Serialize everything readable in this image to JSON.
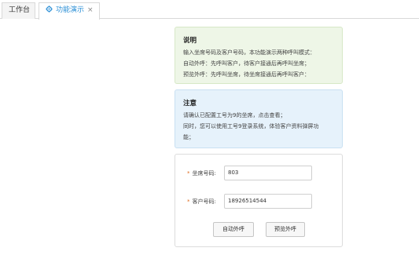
{
  "tabs": {
    "home_label": "工作台",
    "demo_label": "功能演示",
    "close_glyph": "×"
  },
  "description": {
    "title": "说明",
    "lines": [
      "输入坐席号码及客户号码，本功能演示两种呼叫模式：",
      "自动外呼：先呼叫客户，待客户接通后再呼叫坐席；",
      "预览外呼：先呼叫坐席，待坐席接通后再呼叫客户："
    ]
  },
  "note": {
    "title": "注意",
    "lines": [
      "请确认已配置工号为9的坐席，点击查看；",
      "同时，您可以使用工号9登录系统，体验客户资料弹屏功",
      "能；"
    ]
  },
  "form": {
    "required_mark": "*",
    "agent_label": "坐席号码:",
    "agent_value": "803",
    "customer_label": "客户号码:",
    "customer_value": "18926514544",
    "auto_call_label": "自动外呼",
    "preview_call_label": "预览外呼"
  },
  "colors": {
    "accent": "#2b8fd6",
    "desc_bg": "#eef6e7",
    "note_bg": "#e6f2fb",
    "required": "#e06b1f"
  },
  "icons": {
    "demo_tab": "gear-icon",
    "close": "close-icon"
  }
}
